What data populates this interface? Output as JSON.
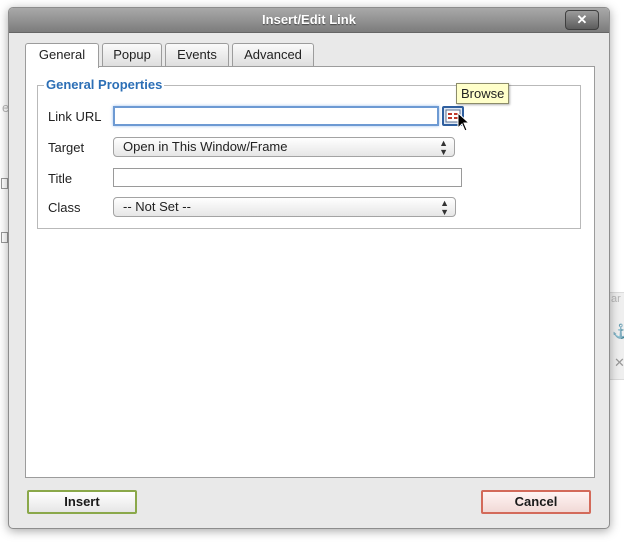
{
  "dialog": {
    "title": "Insert/Edit Link",
    "close_label": "✕"
  },
  "tabs": [
    {
      "label": "General",
      "active": true
    },
    {
      "label": "Popup",
      "active": false
    },
    {
      "label": "Events",
      "active": false
    },
    {
      "label": "Advanced",
      "active": false
    }
  ],
  "general": {
    "legend": "General Properties",
    "link_url": {
      "label": "Link URL",
      "value": ""
    },
    "target": {
      "label": "Target",
      "selected": "Open in This Window/Frame"
    },
    "title": {
      "label": "Title",
      "value": ""
    },
    "class": {
      "label": "Class",
      "selected": "-- Not Set --"
    },
    "browse_tooltip": "Browse"
  },
  "buttons": {
    "insert": "Insert",
    "cancel": "Cancel"
  },
  "background_fragments": {
    "right_text": "ar"
  },
  "colors": {
    "legend": "#2c6fb6",
    "focus_border": "#6d9ad3",
    "insert_border": "#8aa84a",
    "cancel_border": "#d36a5a",
    "tooltip_bg": "#ffffca"
  },
  "icons": {
    "browse": "browse-icon",
    "close": "close-icon",
    "select_arrows": "select-arrows-icon",
    "cursor": "pointer-cursor-icon"
  }
}
